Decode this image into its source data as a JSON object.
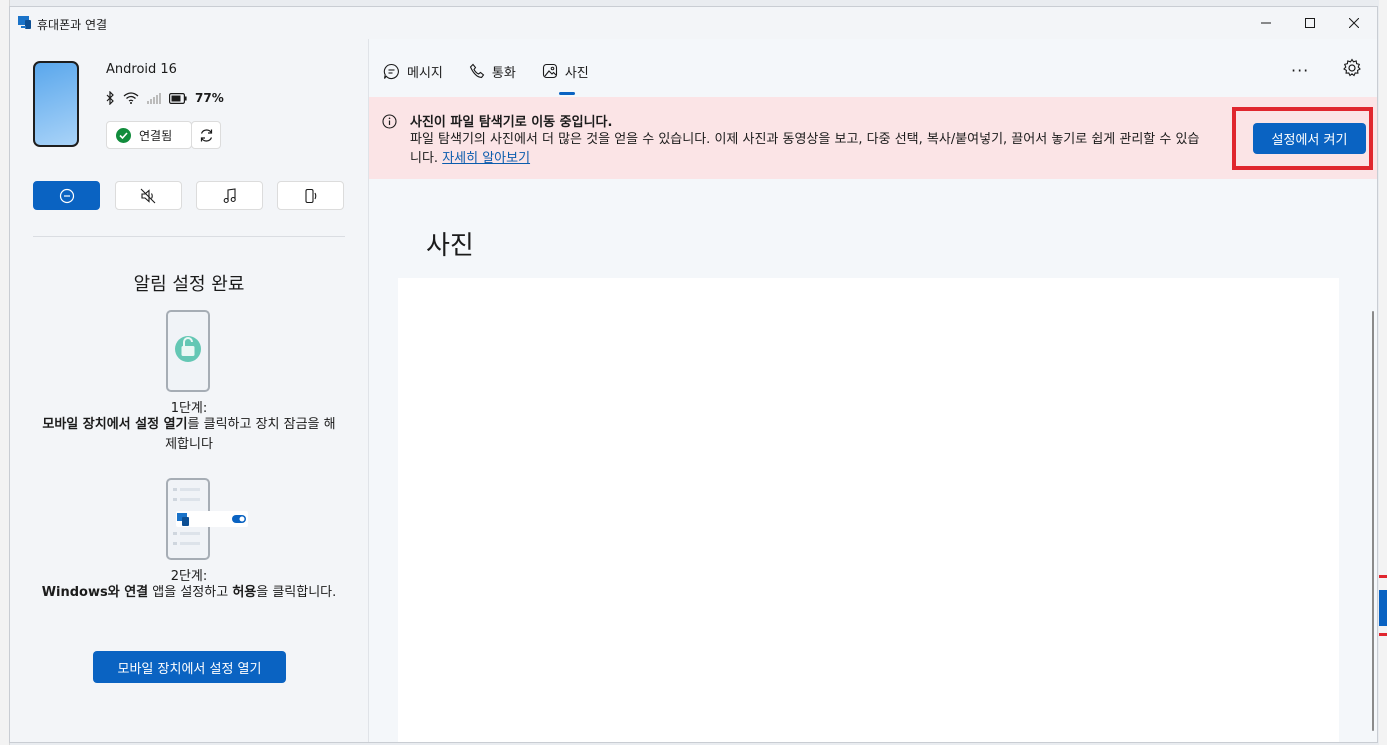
{
  "window": {
    "title": "휴대폰과 연결"
  },
  "device": {
    "name": "Android 16",
    "battery": "77%",
    "connection_status": "연결됨"
  },
  "notifications_setup": {
    "title": "알림 설정 완료",
    "step1_label": "1단계:",
    "step1_bold": "모바일 장치에서 설정 열기",
    "step1_rest": "를 클릭하고 장치 잠금을 해제합니다",
    "step2_label": "2단계:",
    "step2_bold_1": "Windows와 연결",
    "step2_mid": " 앱을 설정하고 ",
    "step2_bold_2": "허용",
    "step2_rest": "을 클릭합니다.",
    "open_button": "모바일 장치에서 설정 열기"
  },
  "tabs": [
    {
      "label": "메시지"
    },
    {
      "label": "통화"
    },
    {
      "label": "사진"
    }
  ],
  "active_tab": "사진",
  "banner": {
    "title": "사진이 파일 탐색기로 이동 중입니다.",
    "body": "파일 탐색기의 사진에서 더 많은 것을 얻을 수 있습니다. 이제 사진과 동영상을 보고, 다중 선택, 복사/붙여넣기, 끌어서 놓기로 쉽게 관리할 수 있습니다. ",
    "link": "자세히 알아보기",
    "button": "설정에서 켜기"
  },
  "photos": {
    "heading": "사진"
  },
  "more_label": "···",
  "colors": {
    "accent": "#0a63c2",
    "banner_bg": "#fbe4e6",
    "highlight": "#e0262e",
    "connected": "#118c3c"
  }
}
